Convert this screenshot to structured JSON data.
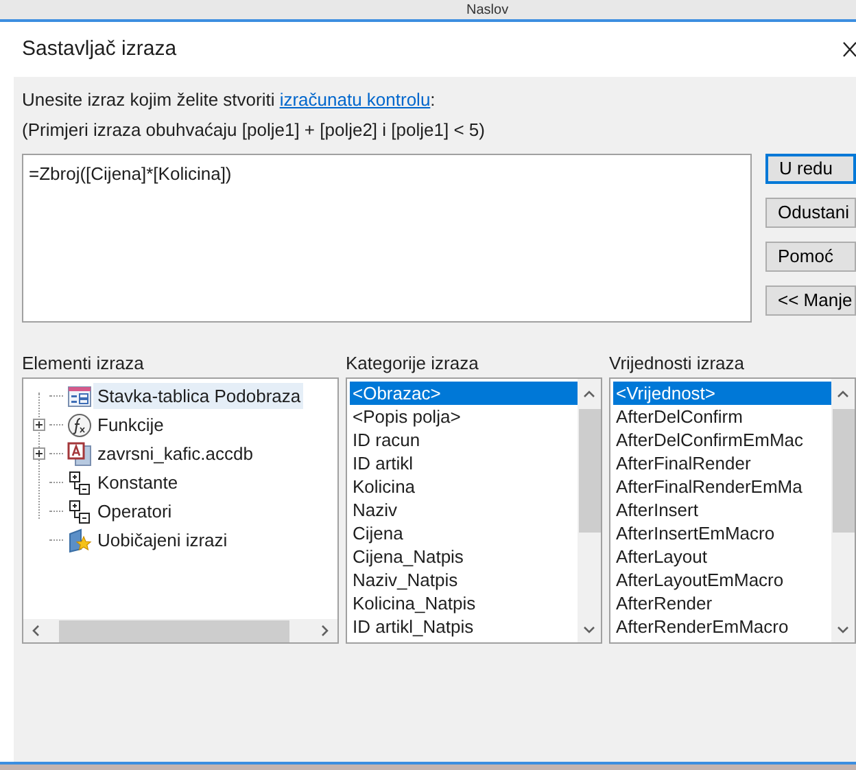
{
  "background": {
    "header_text": "Naslov"
  },
  "dialog": {
    "title": "Sastavljač izraza",
    "instruction": {
      "text": "Unesite izraz kojim želite stvoriti ",
      "link": "izračunatu kontrolu",
      "suffix": ":"
    },
    "example": "(Primjeri izraza obuhvaćaju [polje1] + [polje2] i [polje1] < 5)",
    "expression": "=Zbroj([Cijena]*[Kolicina])",
    "buttons": [
      {
        "label": "U redu",
        "default": true
      },
      {
        "label": "Odustani",
        "default": false
      },
      {
        "label": "Pomoć",
        "default": false
      },
      {
        "label": "<< Manje",
        "default": false
      }
    ],
    "elements": {
      "label": "Elementi izraza",
      "items": [
        {
          "label": "Stavka-tablica Podobraza",
          "kind": "form",
          "expander": false,
          "selected": true
        },
        {
          "label": "Funkcije",
          "kind": "function",
          "expander": true,
          "selected": false
        },
        {
          "label": "zavrsni_kafic.accdb",
          "kind": "database",
          "expander": true,
          "selected": false
        },
        {
          "label": "Konstante",
          "kind": "constants",
          "expander": false,
          "selected": false
        },
        {
          "label": "Operatori",
          "kind": "constants",
          "expander": false,
          "selected": false
        },
        {
          "label": "Uobičajeni izrazi",
          "kind": "common",
          "expander": false,
          "selected": false
        }
      ]
    },
    "categories": {
      "label": "Kategorije izraza",
      "items": [
        {
          "label": "<Obrazac>",
          "selected": true
        },
        {
          "label": "<Popis polja>",
          "selected": false
        },
        {
          "label": "ID racun",
          "selected": false
        },
        {
          "label": "ID artikl",
          "selected": false
        },
        {
          "label": "Kolicina",
          "selected": false
        },
        {
          "label": "Naziv",
          "selected": false
        },
        {
          "label": "Cijena",
          "selected": false
        },
        {
          "label": "Cijena_Natpis",
          "selected": false
        },
        {
          "label": "Naziv_Natpis",
          "selected": false
        },
        {
          "label": "Kolicina_Natpis",
          "selected": false
        },
        {
          "label": "ID artikl_Natpis",
          "selected": false
        }
      ]
    },
    "values": {
      "label": "Vrijednosti izraza",
      "items": [
        {
          "label": "<Vrijednost>",
          "selected": true
        },
        {
          "label": "AfterDelConfirm",
          "selected": false
        },
        {
          "label": "AfterDelConfirmEmMac",
          "selected": false
        },
        {
          "label": "AfterFinalRender",
          "selected": false
        },
        {
          "label": "AfterFinalRenderEmMa",
          "selected": false
        },
        {
          "label": "AfterInsert",
          "selected": false
        },
        {
          "label": "AfterInsertEmMacro",
          "selected": false
        },
        {
          "label": "AfterLayout",
          "selected": false
        },
        {
          "label": "AfterLayoutEmMacro",
          "selected": false
        },
        {
          "label": "AfterRender",
          "selected": false
        },
        {
          "label": "AfterRenderEmMacro",
          "selected": false
        }
      ]
    }
  }
}
